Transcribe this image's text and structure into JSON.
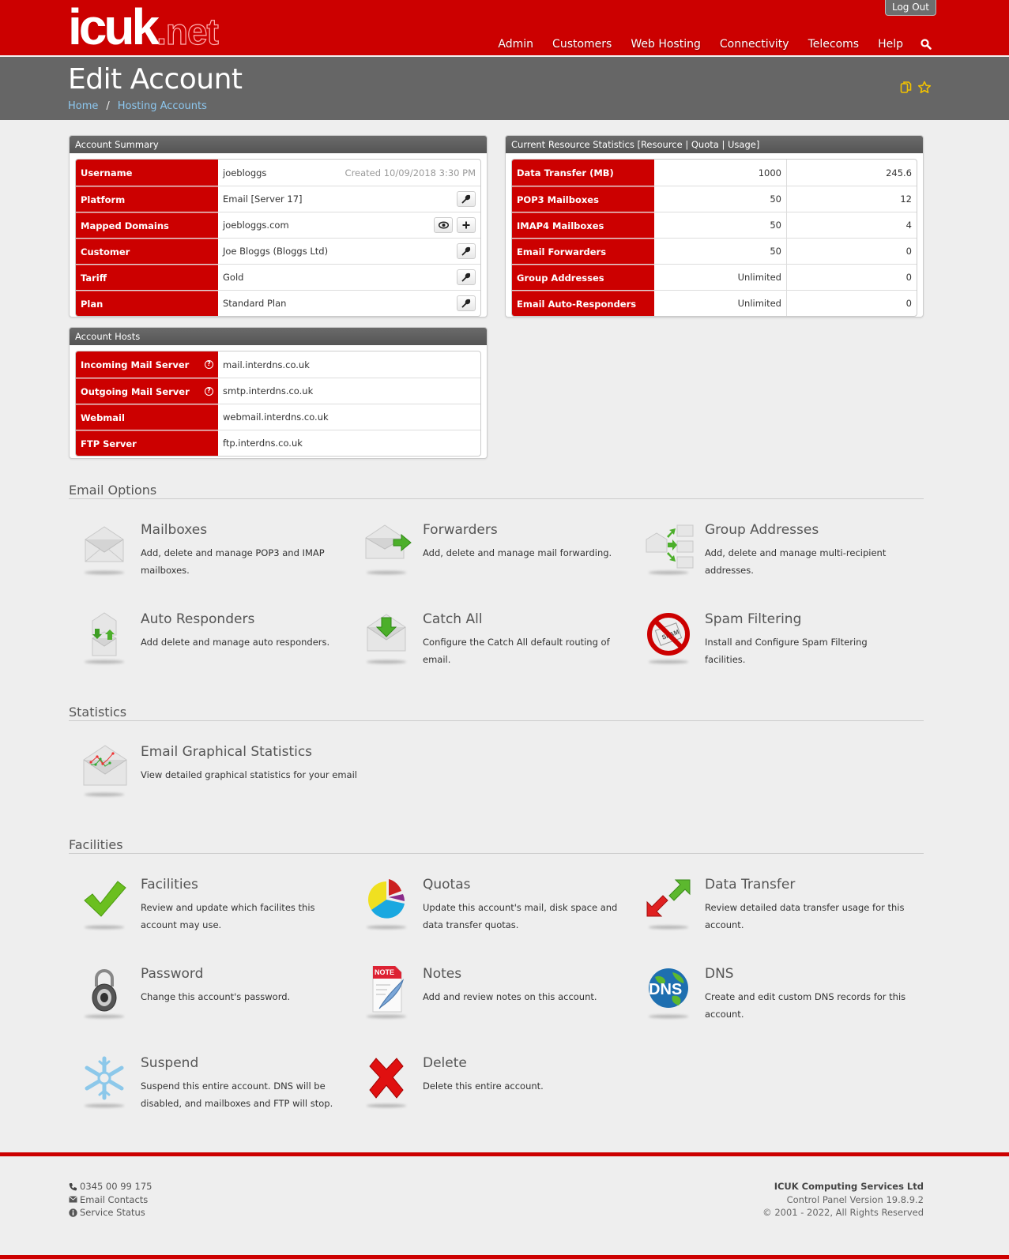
{
  "header": {
    "logo_main": "icuk",
    "logo_suffix": ".net",
    "logout_label": "Log Out",
    "nav": [
      "Admin",
      "Customers",
      "Web Hosting",
      "Connectivity",
      "Telecoms",
      "Help"
    ],
    "search_icon": "search-icon"
  },
  "titlebar": {
    "title": "Edit Account",
    "breadcrumb": [
      "Home",
      "Hosting Accounts"
    ],
    "breadcrumb_sep": "/",
    "icons": [
      "copy-icon",
      "star-icon"
    ]
  },
  "account_summary": {
    "heading": "Account Summary",
    "rows": [
      {
        "key": "Username",
        "value": "joebloggs",
        "extra": "Created 10/09/2018 3:30 PM"
      },
      {
        "key": "Platform",
        "value": "Email [Server 17]",
        "buttons": [
          "wrench"
        ]
      },
      {
        "key": "Mapped Domains",
        "value": "joebloggs.com",
        "buttons": [
          "eye",
          "plus"
        ]
      },
      {
        "key": "Customer",
        "value": "Joe Bloggs (Bloggs Ltd)",
        "buttons": [
          "wrench"
        ]
      },
      {
        "key": "Tariff",
        "value": "Gold",
        "buttons": [
          "wrench"
        ]
      },
      {
        "key": "Plan",
        "value": "Standard Plan",
        "buttons": [
          "wrench"
        ]
      }
    ]
  },
  "resource_stats": {
    "heading": "Current Resource Statistics [Resource | Quota | Usage]",
    "rows": [
      {
        "resource": "Data Transfer (MB)",
        "quota": "1000",
        "usage": "245.6"
      },
      {
        "resource": "POP3 Mailboxes",
        "quota": "50",
        "usage": "12"
      },
      {
        "resource": "IMAP4 Mailboxes",
        "quota": "50",
        "usage": "4"
      },
      {
        "resource": "Email Forwarders",
        "quota": "50",
        "usage": "0"
      },
      {
        "resource": "Group Addresses",
        "quota": "Unlimited",
        "usage": "0"
      },
      {
        "resource": "Email Auto-Responders",
        "quota": "Unlimited",
        "usage": "0"
      }
    ]
  },
  "account_hosts": {
    "heading": "Account Hosts",
    "rows": [
      {
        "key": "Incoming Mail Server",
        "value": "mail.interdns.co.uk",
        "help": true
      },
      {
        "key": "Outgoing Mail Server",
        "value": "smtp.interdns.co.uk",
        "help": true
      },
      {
        "key": "Webmail",
        "value": "webmail.interdns.co.uk"
      },
      {
        "key": "FTP Server",
        "value": "ftp.interdns.co.uk"
      }
    ]
  },
  "sections": {
    "email_options": {
      "title": "Email Options",
      "tiles": [
        {
          "title": "Mailboxes",
          "desc": "Add, delete and manage POP3 and IMAP mailboxes.",
          "icon": "envelope-icon"
        },
        {
          "title": "Forwarders",
          "desc": "Add, delete and manage mail forwarding.",
          "icon": "envelope-forward-icon"
        },
        {
          "title": "Group Addresses",
          "desc": "Add, delete and manage multi-recipient addresses.",
          "icon": "group-envelopes-icon"
        },
        {
          "title": "Auto Responders",
          "desc": "Add delete and manage auto responders.",
          "icon": "auto-responder-icon"
        },
        {
          "title": "Catch All",
          "desc": "Configure the Catch All default routing of email.",
          "icon": "catch-all-icon"
        },
        {
          "title": "Spam Filtering",
          "desc": "Install and Configure Spam Filtering facilities.",
          "icon": "no-spam-icon"
        }
      ]
    },
    "statistics": {
      "title": "Statistics",
      "tiles": [
        {
          "title": "Email Graphical Statistics",
          "desc": "View detailed graphical statistics for your email",
          "icon": "envelope-chart-icon"
        }
      ]
    },
    "facilities": {
      "title": "Facilities",
      "tiles": [
        {
          "title": "Facilities",
          "desc": "Review and update which facilites this account may use.",
          "icon": "checkmark-icon"
        },
        {
          "title": "Quotas",
          "desc": "Update this account's mail, disk space and data transfer quotas.",
          "icon": "pie-chart-icon"
        },
        {
          "title": "Data Transfer",
          "desc": "Review detailed data transfer usage for this account.",
          "icon": "transfer-arrows-icon"
        },
        {
          "title": "Password",
          "desc": "Change this account's password.",
          "icon": "padlock-icon"
        },
        {
          "title": "Notes",
          "desc": "Add and review notes on this account.",
          "icon": "note-icon"
        },
        {
          "title": "DNS",
          "desc": "Create and edit custom DNS records for this account.",
          "icon": "dns-globe-icon"
        },
        {
          "title": "Suspend",
          "desc": "Suspend this entire account. DNS will be disabled, and mailboxes and FTP will stop.",
          "icon": "snowflake-icon"
        },
        {
          "title": "Delete",
          "desc": "Delete this entire account.",
          "icon": "red-x-icon"
        }
      ]
    }
  },
  "footer": {
    "phone": "0345 00 99 175",
    "email_contacts": "Email Contacts",
    "service_status": "Service Status",
    "company": "ICUK Computing Services Ltd",
    "version": "Control Panel Version 19.8.9.2",
    "copyright": "© 2001 - 2022, All Rights Reserved"
  },
  "colors": {
    "brand_red": "#cc0000",
    "title_gray": "#666666",
    "accent_yellow": "#f2c200",
    "link_blue": "#8dc8f0"
  }
}
